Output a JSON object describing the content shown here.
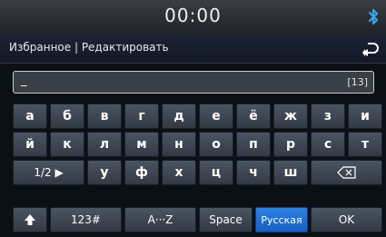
{
  "status": {
    "time": "00:00",
    "bluetooth_icon": "bluetooth-icon"
  },
  "header": {
    "title": "Избранное | Редактировать",
    "back_icon": "back-arrow-icon"
  },
  "input": {
    "value": "_",
    "counter": "[13]"
  },
  "keyboard": {
    "row1": [
      "а",
      "б",
      "в",
      "г",
      "д",
      "е",
      "ё",
      "ж",
      "з",
      "и"
    ],
    "row2": [
      "й",
      "к",
      "л",
      "м",
      "н",
      "о",
      "п",
      "р",
      "с",
      "т"
    ],
    "row3": {
      "page_toggle": "1/2 ▶",
      "letters": [
        "у",
        "ф",
        "х",
        "ц",
        "ч",
        "ш"
      ],
      "backspace_icon": "backspace-icon"
    },
    "row4": {
      "shift_icon": "shift-arrow-icon",
      "numbers": "123#",
      "latin": "A···Z",
      "space": "Space",
      "language": "Русская",
      "ok": "OK"
    }
  },
  "colors": {
    "active_key": "#1f6fd6",
    "key": "#3f4854",
    "background": "#0b0f16"
  }
}
